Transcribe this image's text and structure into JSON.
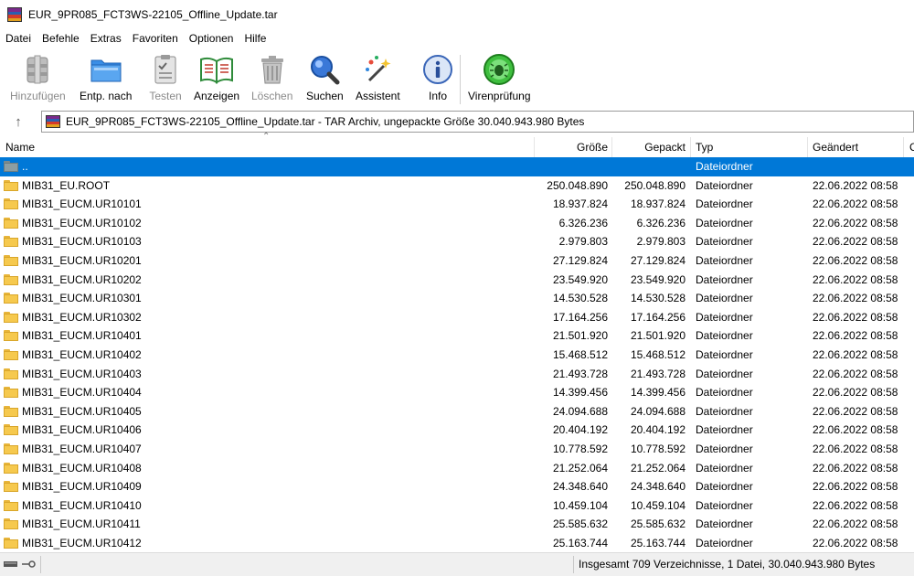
{
  "window": {
    "title": "EUR_9PR085_FCT3WS-22105_Offline_Update.tar"
  },
  "menu": [
    "Datei",
    "Befehle",
    "Extras",
    "Favoriten",
    "Optionen",
    "Hilfe"
  ],
  "toolbar": [
    {
      "label": "Hinzufügen",
      "icon": "add-archive-icon",
      "enabled": false
    },
    {
      "label": "Entp. nach",
      "icon": "extract-folder-icon",
      "enabled": true
    },
    {
      "label": "Testen",
      "icon": "test-clipboard-icon",
      "enabled": false
    },
    {
      "label": "Anzeigen",
      "icon": "view-book-icon",
      "enabled": true
    },
    {
      "label": "Löschen",
      "icon": "trash-icon",
      "enabled": false
    },
    {
      "label": "Suchen",
      "icon": "search-magnifier-icon",
      "enabled": true
    },
    {
      "label": "Assistent",
      "icon": "wizard-wand-icon",
      "enabled": true
    },
    {
      "label": "Info",
      "icon": "info-icon",
      "enabled": true
    },
    {
      "label": "Virenprüfung",
      "icon": "virus-scan-icon",
      "enabled": true
    }
  ],
  "address": {
    "text": "EUR_9PR085_FCT3WS-22105_Offline_Update.tar - TAR Archiv, ungepackte Größe 30.040.943.980 Bytes"
  },
  "columns": {
    "name": "Name",
    "size": "Größe",
    "packed": "Gepackt",
    "type": "Typ",
    "modified": "Geändert",
    "extra": "C"
  },
  "files": [
    {
      "name": "..",
      "size": "",
      "packed": "",
      "type": "Dateiordner",
      "modified": ""
    },
    {
      "name": "MIB31_EU.ROOT",
      "size": "250.048.890",
      "packed": "250.048.890",
      "type": "Dateiordner",
      "modified": "22.06.2022 08:58"
    },
    {
      "name": "MIB31_EUCM.UR10101",
      "size": "18.937.824",
      "packed": "18.937.824",
      "type": "Dateiordner",
      "modified": "22.06.2022 08:58"
    },
    {
      "name": "MIB31_EUCM.UR10102",
      "size": "6.326.236",
      "packed": "6.326.236",
      "type": "Dateiordner",
      "modified": "22.06.2022 08:58"
    },
    {
      "name": "MIB31_EUCM.UR10103",
      "size": "2.979.803",
      "packed": "2.979.803",
      "type": "Dateiordner",
      "modified": "22.06.2022 08:58"
    },
    {
      "name": "MIB31_EUCM.UR10201",
      "size": "27.129.824",
      "packed": "27.129.824",
      "type": "Dateiordner",
      "modified": "22.06.2022 08:58"
    },
    {
      "name": "MIB31_EUCM.UR10202",
      "size": "23.549.920",
      "packed": "23.549.920",
      "type": "Dateiordner",
      "modified": "22.06.2022 08:58"
    },
    {
      "name": "MIB31_EUCM.UR10301",
      "size": "14.530.528",
      "packed": "14.530.528",
      "type": "Dateiordner",
      "modified": "22.06.2022 08:58"
    },
    {
      "name": "MIB31_EUCM.UR10302",
      "size": "17.164.256",
      "packed": "17.164.256",
      "type": "Dateiordner",
      "modified": "22.06.2022 08:58"
    },
    {
      "name": "MIB31_EUCM.UR10401",
      "size": "21.501.920",
      "packed": "21.501.920",
      "type": "Dateiordner",
      "modified": "22.06.2022 08:58"
    },
    {
      "name": "MIB31_EUCM.UR10402",
      "size": "15.468.512",
      "packed": "15.468.512",
      "type": "Dateiordner",
      "modified": "22.06.2022 08:58"
    },
    {
      "name": "MIB31_EUCM.UR10403",
      "size": "21.493.728",
      "packed": "21.493.728",
      "type": "Dateiordner",
      "modified": "22.06.2022 08:58"
    },
    {
      "name": "MIB31_EUCM.UR10404",
      "size": "14.399.456",
      "packed": "14.399.456",
      "type": "Dateiordner",
      "modified": "22.06.2022 08:58"
    },
    {
      "name": "MIB31_EUCM.UR10405",
      "size": "24.094.688",
      "packed": "24.094.688",
      "type": "Dateiordner",
      "modified": "22.06.2022 08:58"
    },
    {
      "name": "MIB31_EUCM.UR10406",
      "size": "20.404.192",
      "packed": "20.404.192",
      "type": "Dateiordner",
      "modified": "22.06.2022 08:58"
    },
    {
      "name": "MIB31_EUCM.UR10407",
      "size": "10.778.592",
      "packed": "10.778.592",
      "type": "Dateiordner",
      "modified": "22.06.2022 08:58"
    },
    {
      "name": "MIB31_EUCM.UR10408",
      "size": "21.252.064",
      "packed": "21.252.064",
      "type": "Dateiordner",
      "modified": "22.06.2022 08:58"
    },
    {
      "name": "MIB31_EUCM.UR10409",
      "size": "24.348.640",
      "packed": "24.348.640",
      "type": "Dateiordner",
      "modified": "22.06.2022 08:58"
    },
    {
      "name": "MIB31_EUCM.UR10410",
      "size": "10.459.104",
      "packed": "10.459.104",
      "type": "Dateiordner",
      "modified": "22.06.2022 08:58"
    },
    {
      "name": "MIB31_EUCM.UR10411",
      "size": "25.585.632",
      "packed": "25.585.632",
      "type": "Dateiordner",
      "modified": "22.06.2022 08:58"
    },
    {
      "name": "MIB31_EUCM.UR10412",
      "size": "25.163.744",
      "packed": "25.163.744",
      "type": "Dateiordner",
      "modified": "22.06.2022 08:58"
    }
  ],
  "status": {
    "text": "Insgesamt 709 Verzeichnisse, 1 Datei, 30.040.943.980 Bytes"
  },
  "colors": {
    "selection": "#0078d7",
    "folder": "#f6c94e"
  }
}
